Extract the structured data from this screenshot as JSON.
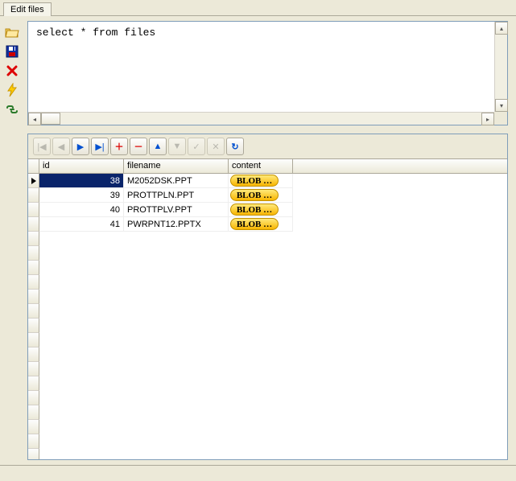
{
  "tab": {
    "label": "Edit files"
  },
  "sql": {
    "query": "select * from files"
  },
  "nav": {
    "first": "|◀",
    "prev": "◀",
    "next": "▶",
    "last": "▶|",
    "add": "＋",
    "delete": "－",
    "up": "▲",
    "down": "▼",
    "check": "✓",
    "cancel": "✕",
    "refresh": "↻"
  },
  "columns": {
    "id": "id",
    "filename": "filename",
    "content": "content"
  },
  "blob_label": "BLOB …",
  "rows": [
    {
      "id": "38",
      "filename": "M2052DSK.PPT"
    },
    {
      "id": "39",
      "filename": "PROTTPLN.PPT"
    },
    {
      "id": "40",
      "filename": "PROTTPLV.PPT"
    },
    {
      "id": "41",
      "filename": "PWRPNT12.PPTX"
    }
  ]
}
